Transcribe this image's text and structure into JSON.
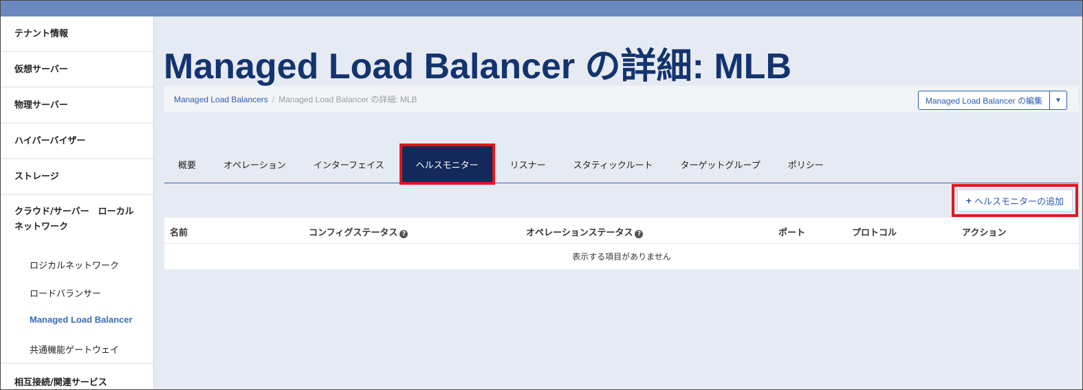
{
  "sidebar": {
    "items": [
      {
        "label": "テナント情報"
      },
      {
        "label": "仮想サーバー"
      },
      {
        "label": "物理サーバー"
      },
      {
        "label": "ハイパーバイザー"
      },
      {
        "label": "ストレージ"
      },
      {
        "label": "クラウド/サーバー　ローカルネットワーク"
      }
    ],
    "subitems": [
      {
        "label": "ロジカルネットワーク"
      },
      {
        "label": "ロードバランサー"
      },
      {
        "label": "Managed Load Balancer"
      },
      {
        "label": "共通機能ゲートウェイ"
      }
    ],
    "last_item": "相互接続/関連サービス"
  },
  "page": {
    "title": "Managed Load Balancer の詳細: MLB"
  },
  "breadcrumb": {
    "link": "Managed Load Balancers",
    "separator": "/",
    "current": "Managed Load Balancer の詳細: MLB"
  },
  "actions": {
    "edit_label": "Managed Load Balancer の編集",
    "caret": "▼"
  },
  "tabs": [
    {
      "label": "概要"
    },
    {
      "label": "オペレーション"
    },
    {
      "label": "インターフェイス"
    },
    {
      "label": "ヘルスモニター"
    },
    {
      "label": "リスナー"
    },
    {
      "label": "スタティックルート"
    },
    {
      "label": "ターゲットグループ"
    },
    {
      "label": "ポリシー"
    }
  ],
  "add_button": {
    "plus": "+",
    "label": "ヘルスモニターの追加"
  },
  "table": {
    "columns": [
      {
        "label": "名前"
      },
      {
        "label": "コンフィグステータス"
      },
      {
        "label": "オペレーションステータス"
      },
      {
        "label": "ポート"
      },
      {
        "label": "プロトコル"
      },
      {
        "label": "アクション"
      }
    ],
    "help_icon": "?",
    "empty_message": "表示する項目がありません"
  },
  "colors": {
    "topbar": "#6b88bf",
    "active_tab": "#13295b",
    "highlight": "#e2161d",
    "link": "#2c5ab0"
  }
}
